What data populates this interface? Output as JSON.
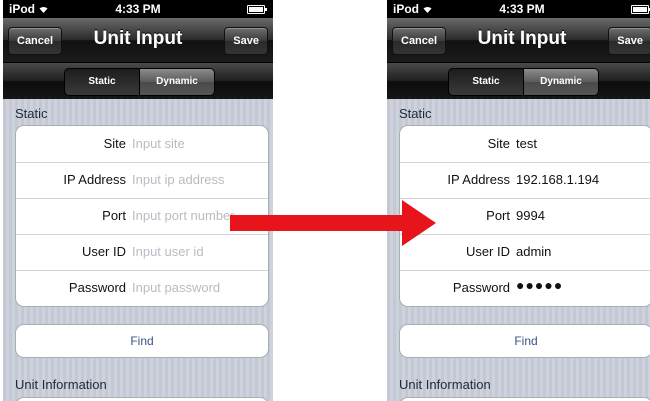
{
  "screens": [
    {
      "status": {
        "carrier": "iPod",
        "time": "4:33 PM"
      },
      "nav": {
        "cancel": "Cancel",
        "title": "Unit Input",
        "save": "Save"
      },
      "segments": {
        "static": "Static",
        "dynamic": "Dynamic"
      },
      "section_static": "Static",
      "fields": [
        {
          "label": "Site",
          "value": "Input site"
        },
        {
          "label": "IP Address",
          "value": "Input ip address"
        },
        {
          "label": "Port",
          "value": "Input port number"
        },
        {
          "label": "User ID",
          "value": "Input user id"
        },
        {
          "label": "Password",
          "value": "Input password"
        }
      ],
      "find": "Find",
      "section_info": "Unit Information"
    },
    {
      "status": {
        "carrier": "iPod",
        "time": "4:33 PM"
      },
      "nav": {
        "cancel": "Cancel",
        "title": "Unit Input",
        "save": "Save"
      },
      "segments": {
        "static": "Static",
        "dynamic": "Dynamic"
      },
      "section_static": "Static",
      "fields": [
        {
          "label": "Site",
          "value": "test"
        },
        {
          "label": "IP Address",
          "value": "192.168.1.194"
        },
        {
          "label": "Port",
          "value": "9994"
        },
        {
          "label": "User ID",
          "value": "admin"
        },
        {
          "label": "Password",
          "value": "●●●●●"
        }
      ],
      "find": "Find",
      "section_info": "Unit Information"
    }
  ],
  "colors": {
    "arrow": "#e8141b",
    "find_text": "#385487"
  }
}
